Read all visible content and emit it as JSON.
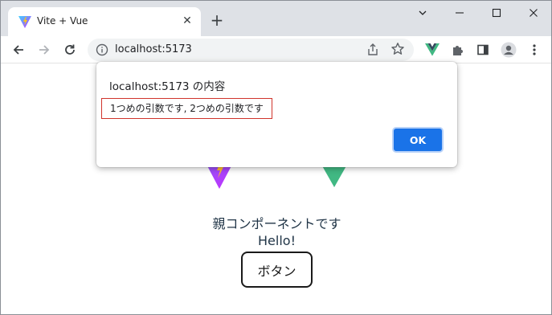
{
  "browser": {
    "tab_title": "Vite + Vue",
    "url": "localhost:5173"
  },
  "page": {
    "parent_text": "親コンポーネントです",
    "hello_text": "Hello!",
    "button_label": "ボタン"
  },
  "dialog": {
    "title": "localhost:5173 の内容",
    "message": "1つめの引数です, 2つめの引数です",
    "ok_label": "OK"
  },
  "colors": {
    "accent": "#1a73e8",
    "vue_green": "#41b883",
    "vite_purple": "#a855f7",
    "highlight_border": "#d0342c"
  }
}
